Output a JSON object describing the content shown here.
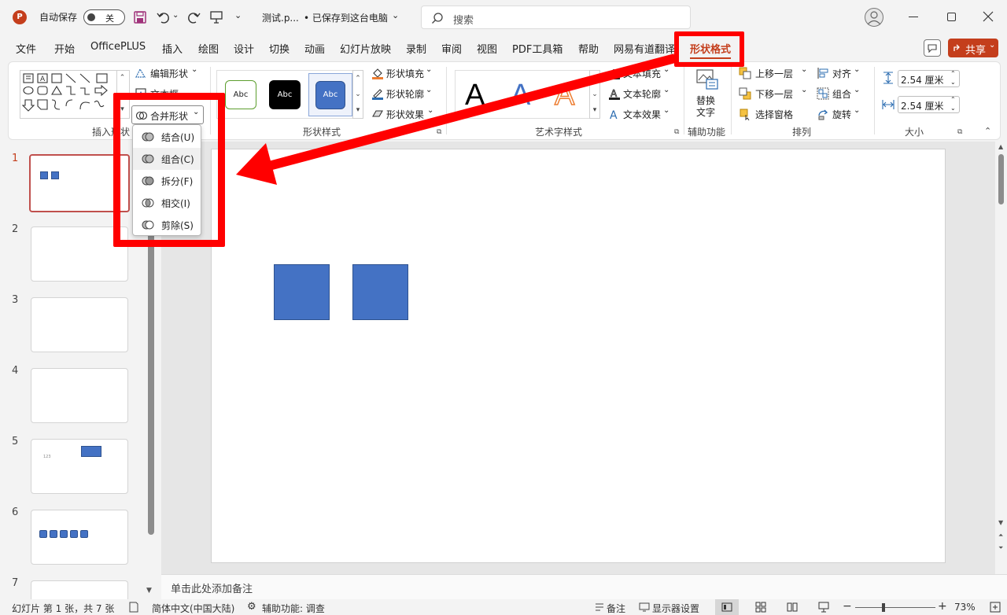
{
  "titlebar": {
    "autosave_label": "自动保存",
    "autosave_state": "关",
    "file_name": "测试.p...",
    "save_status": "• 已保存到这台电脑",
    "search_placeholder": "搜索"
  },
  "menu": {
    "tabs": [
      "文件",
      "开始",
      "OfficePLUS",
      "插入",
      "绘图",
      "设计",
      "切换",
      "动画",
      "幻灯片放映",
      "录制",
      "审阅",
      "视图",
      "PDF工具箱",
      "帮助",
      "网易有道翻译",
      "形状格式"
    ],
    "active": "形状格式",
    "share_label": "共享"
  },
  "ribbon": {
    "insert_shapes": {
      "edit_shape": "编辑形状",
      "text_box": "文本框",
      "merge_shapes": "合并形状",
      "label": "插入形状"
    },
    "shape_styles": {
      "preset_labels": [
        "Abc",
        "Abc",
        "Abc"
      ],
      "fill": "形状填充",
      "outline": "形状轮廓",
      "effects": "形状效果",
      "label": "形状样式"
    },
    "wordart": {
      "preset_letters": [
        "A",
        "A",
        "A"
      ],
      "fill": "文本填充",
      "outline": "文本轮廓",
      "effects": "文本效果",
      "label": "艺术字样式"
    },
    "accessibility": {
      "alt_text_line1": "替换",
      "alt_text_line2": "文字",
      "label": "辅助功能"
    },
    "arrange": {
      "bring_forward": "上移一层",
      "send_backward": "下移一层",
      "selection_pane": "选择窗格",
      "align": "对齐",
      "group": "组合",
      "rotate": "旋转",
      "label": "排列"
    },
    "size": {
      "height": "2.54 厘米",
      "width": "2.54 厘米",
      "label": "大小"
    }
  },
  "merge_menu": {
    "items": [
      "结合(U)",
      "组合(C)",
      "拆分(F)",
      "相交(I)",
      "剪除(S)"
    ]
  },
  "slides": {
    "numbers": [
      "1",
      "2",
      "3",
      "4",
      "5",
      "6",
      "7"
    ],
    "slide5_caption": "123"
  },
  "notes_placeholder": "单击此处添加备注",
  "status": {
    "slide_info": "幻灯片 第 1 张，共 7 张",
    "language": "简体中文(中国大陆)",
    "accessibility": "辅助功能: 调查",
    "notes": "备注",
    "display_settings": "显示器设置",
    "zoom": "73%"
  },
  "colors": {
    "accent_red": "#c43e1c",
    "shape_blue": "#4472c4",
    "annotation_red": "#ff0000"
  }
}
